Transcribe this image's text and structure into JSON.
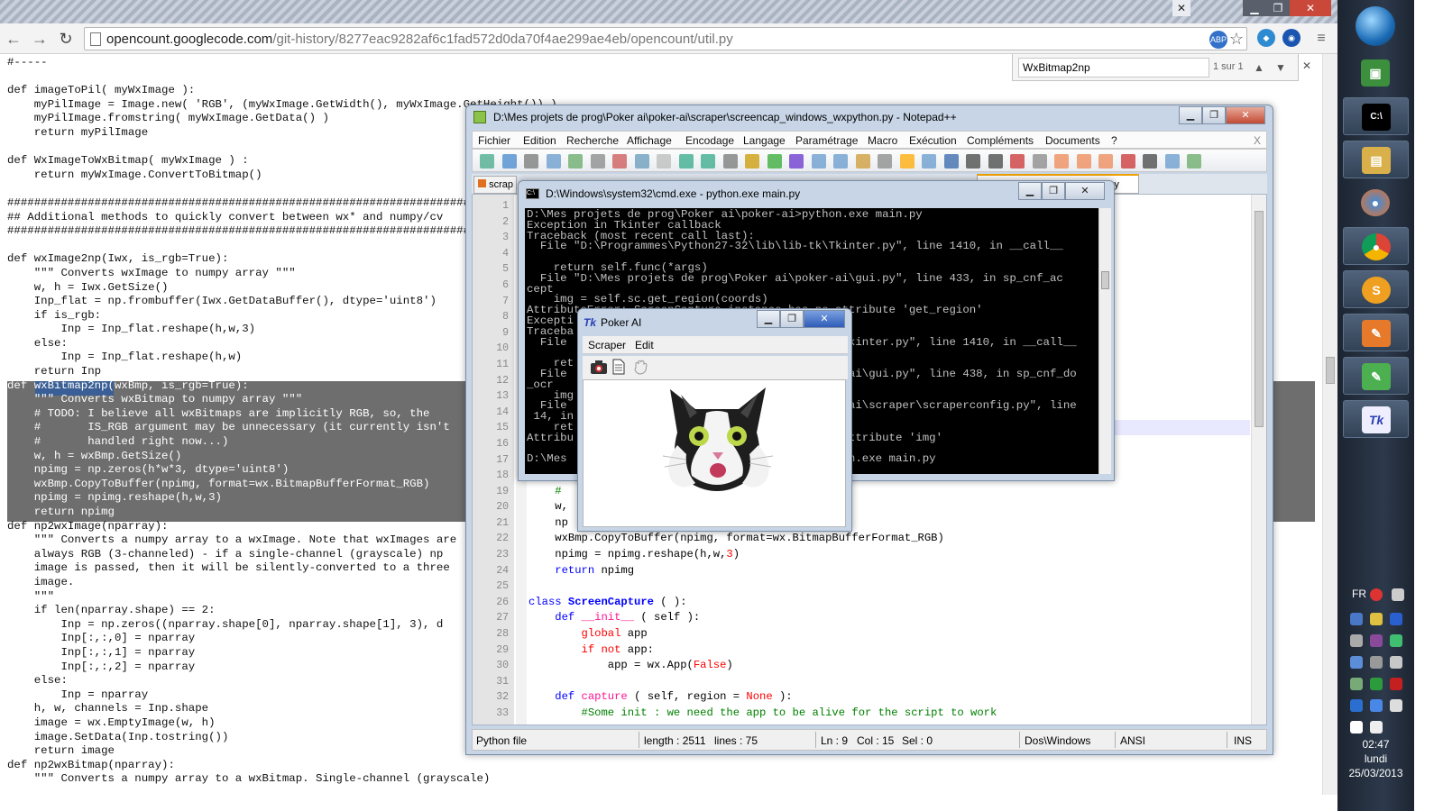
{
  "browser": {
    "url_host": "opencount.googlecode.com",
    "url_path": "/git-history/8277eac9282af6c1fad572d0da70f4ae299ae4eb/opencount/util.py",
    "find_query": "WxBitmap2np",
    "find_count": "1 sur 1"
  },
  "page_code": [
    "#-----",
    "",
    "def imageToPil( myWxImage ):",
    "    myPilImage = Image.new( 'RGB', (myWxImage.GetWidth(), myWxImage.GetHeight()) )",
    "    myPilImage.fromstring( myWxImage.GetData() )",
    "    return myPilImage",
    "",
    "def WxImageToWxBitmap( myWxImage ) :",
    "    return myWxImage.ConvertToBitmap()",
    "",
    "#########################################################################",
    "## Additional methods to quickly convert between wx* and numpy/cv",
    "#########################################################################",
    "",
    "def wxImage2np(Iwx, is_rgb=True):",
    "    \"\"\" Converts wxImage to numpy array \"\"\"",
    "    w, h = Iwx.GetSize()",
    "    Inp_flat = np.frombuffer(Iwx.GetDataBuffer(), dtype='uint8')",
    "    if is_rgb:",
    "        Inp = Inp_flat.reshape(h,w,3)",
    "    else:",
    "        Inp = Inp_flat.reshape(h,w)",
    "    return Inp",
    "def wxBitmap2np(wxBmp, is_rgb=True):",
    "    \"\"\" Converts wxBitmap to numpy array \"\"\"",
    "    # TODO: I believe all wxBitmaps are implicitly RGB, so, the",
    "    #       IS_RGB argument may be unnecessary (it currently isn't",
    "    #       handled right now...)",
    "    w, h = wxBmp.GetSize()",
    "    npimg = np.zeros(h*w*3, dtype='uint8')",
    "    wxBmp.CopyToBuffer(npimg, format=wx.BitmapBufferFormat_RGB)",
    "    npimg = npimg.reshape(h,w,3)",
    "    return npimg",
    "def np2wxImage(nparray):",
    "    \"\"\" Converts a numpy array to a wxImage. Note that wxImages are",
    "    always RGB (3-channeled) - if a single-channel (grayscale) np",
    "    image is passed, then it will be silently-converted to a three",
    "    image.",
    "    \"\"\"",
    "    if len(nparray.shape) == 2:",
    "        Inp = np.zeros((nparray.shape[0], nparray.shape[1], 3), d",
    "        Inp[:,:,0] = nparray",
    "        Inp[:,:,1] = nparray",
    "        Inp[:,:,2] = nparray",
    "    else:",
    "        Inp = nparray",
    "    h, w, channels = Inp.shape",
    "    image = wx.EmptyImage(w, h)",
    "    image.SetData(Inp.tostring())",
    "    return image",
    "def np2wxBitmap(nparray):",
    "    \"\"\" Converts a numpy array to a wxBitmap. Single-channel (grayscale)"
  ],
  "notepad": {
    "title": "D:\\Mes projets de prog\\Poker ai\\poker-ai\\scraper\\screencap_windows_wxpython.py - Notepad++",
    "menu": [
      "Fichier",
      "Edition",
      "Recherche",
      "Affichage",
      "Encodage",
      "Langage",
      "Paramétrage",
      "Macro",
      "Exécution",
      "Compléments",
      "Documents",
      "?"
    ],
    "close_x": "X",
    "tab_left": "scrap",
    "tab_right": "on.py",
    "line_numbers": "1\n2\n3\n4\n5\n6\n7\n8\n9\n10\n11\n12\n13\n14\n15\n16\n17\n18\n19\n20\n21\n22\n23\n24\n25\n26\n27\n28\n29\n30\n31\n32\n33",
    "status": {
      "type": "Python file",
      "length": "length : 2511",
      "lines": "lines : 75",
      "ln": "Ln : 9",
      "col": "Col : 15",
      "sel": "Sel : 0",
      "eol": "Dos\\Windows",
      "enc": "ANSI",
      "mode": "INS"
    }
  },
  "cmd": {
    "title": "D:\\Windows\\system32\\cmd.exe - python.exe  main.py",
    "lines": [
      "D:\\Mes projets de prog\\Poker ai\\poker-ai>python.exe main.py",
      "Exception in Tkinter callback",
      "Traceback (most recent call last):",
      "  File \"D:\\Programmes\\Python27-32\\lib\\lib-tk\\Tkinter.py\", line 1410, in __call__",
      "",
      "    return self.func(*args)",
      "  File \"D:\\Mes projets de prog\\Poker ai\\poker-ai\\gui.py\", line 433, in sp_cnf_ac",
      "cept",
      "    img = self.sc.get_region(coords)",
      "AttributeError: ScreenCapture instance has no attribute 'get_region'",
      "Excepti",
      "Traceba",
      "  File                                          kinter.py\", line 1410, in __call__",
      "",
      "    ret",
      "  File                                          ai\\gui.py\", line 438, in sp_cnf_do",
      "_ocr",
      "    img",
      "  File                                          ai\\scraper\\scraperconfig.py\", line",
      " 14, in",
      "    ret",
      "Attribu                                        attribute 'img'",
      "",
      "D:\\Mes                                         on.exe main.py"
    ]
  },
  "tk": {
    "title": "Poker AI",
    "icon_text": "Tk",
    "menu": [
      "Scraper",
      "Edit"
    ]
  },
  "taskbar": {
    "lang": "FR",
    "time": "02:47",
    "day": "lundi",
    "date": "25/03/2013",
    "tk_label": "Tk"
  },
  "colors": {
    "accent": "#3a5f96",
    "highlight": "#6e6e6e",
    "npp_keyword": "#0000ff",
    "npp_comment": "#008000",
    "npp_number": "#ff0000"
  }
}
